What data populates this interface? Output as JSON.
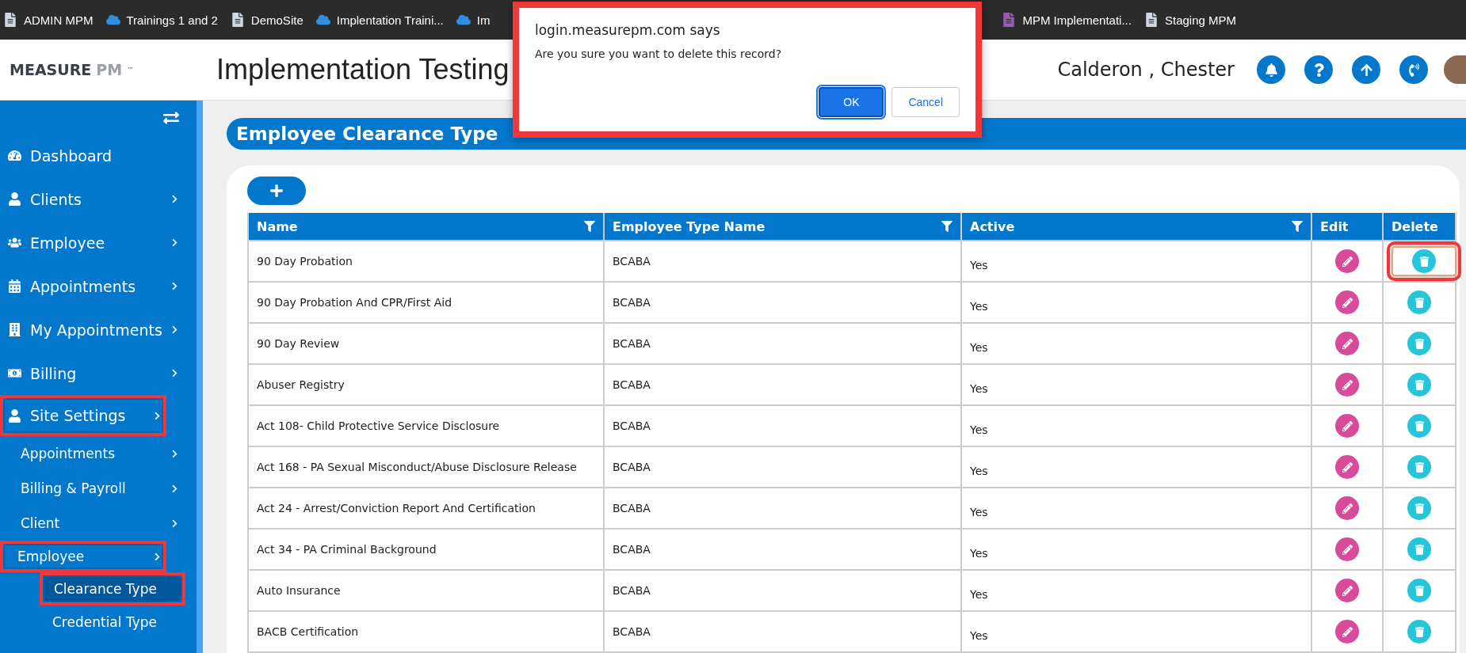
{
  "bookmarks": [
    {
      "label": "ADMIN MPM"
    },
    {
      "label": "Trainings 1 and 2"
    },
    {
      "label": "DemoSite"
    },
    {
      "label": "Implentation Traini..."
    },
    {
      "label": "Im"
    },
    {
      "label": "MPM Implementati..."
    },
    {
      "label": "Staging MPM"
    }
  ],
  "header": {
    "logo_main": "MEASURE",
    "logo_accent": "PM",
    "logo_tm": "™",
    "title": "Implementation Testing",
    "user": "Calderon , Chester",
    "actions": [
      {
        "kind": "bell"
      },
      {
        "kind": "help"
      },
      {
        "kind": "upload"
      },
      {
        "kind": "phone"
      }
    ]
  },
  "sidebar": {
    "items": [
      {
        "label": "Dashboard",
        "expandable": false,
        "highlighted": false
      },
      {
        "label": "Clients",
        "expandable": true,
        "highlighted": false
      },
      {
        "label": "Employee",
        "expandable": true,
        "highlighted": false
      },
      {
        "label": "Appointments",
        "expandable": true,
        "highlighted": false
      },
      {
        "label": "My Appointments",
        "expandable": true,
        "highlighted": false
      },
      {
        "label": "Billing",
        "expandable": true,
        "highlighted": false
      },
      {
        "label": "Site Settings",
        "expandable": true,
        "highlighted": true,
        "children": [
          {
            "label": "Appointments",
            "expandable": true,
            "highlighted": false
          },
          {
            "label": "Billing & Payroll",
            "expandable": true,
            "highlighted": false
          },
          {
            "label": "Client",
            "expandable": true,
            "highlighted": false
          },
          {
            "label": "Employee",
            "expandable": true,
            "highlighted": true,
            "children": [
              {
                "label": "Clearance Type",
                "selected": true,
                "highlighted": true
              },
              {
                "label": "Credential Type",
                "selected": false,
                "highlighted": false
              }
            ]
          }
        ]
      }
    ]
  },
  "page_title": "Employee Clearance Type",
  "table": {
    "columns": [
      {
        "label": "Name",
        "filter": true
      },
      {
        "label": "Employee Type Name",
        "filter": true
      },
      {
        "label": "Active",
        "filter": true
      },
      {
        "label": "Edit",
        "filter": false
      },
      {
        "label": "Delete",
        "filter": false
      }
    ],
    "rows": [
      {
        "name": "90 Day Probation",
        "type": "BCABA",
        "active": "Yes",
        "delete_highlighted": true
      },
      {
        "name": "90 Day Probation And CPR/First Aid",
        "type": "BCABA",
        "active": "Yes",
        "delete_highlighted": false
      },
      {
        "name": "90 Day Review",
        "type": "BCABA",
        "active": "Yes",
        "delete_highlighted": false
      },
      {
        "name": "Abuser Registry",
        "type": "BCABA",
        "active": "Yes",
        "delete_highlighted": false
      },
      {
        "name": "Act 108- Child Protective Service Disclosure",
        "type": "BCABA",
        "active": "Yes",
        "delete_highlighted": false
      },
      {
        "name": "Act 168 - PA Sexual Misconduct/Abuse Disclosure Release",
        "type": "BCABA",
        "active": "Yes",
        "delete_highlighted": false
      },
      {
        "name": "Act 24 - Arrest/Conviction Report And Certification",
        "type": "BCABA",
        "active": "Yes",
        "delete_highlighted": false
      },
      {
        "name": "Act 34 - PA Criminal Background",
        "type": "BCABA",
        "active": "Yes",
        "delete_highlighted": false
      },
      {
        "name": "Auto Insurance",
        "type": "BCABA",
        "active": "Yes",
        "delete_highlighted": false
      },
      {
        "name": "BACB Certification",
        "type": "BCABA",
        "active": "Yes",
        "delete_highlighted": false
      }
    ]
  },
  "dialog": {
    "title": "login.measurepm.com says",
    "message": "Are you sure you want to delete this record?",
    "buttons": [
      {
        "label": "OK",
        "selected": true
      },
      {
        "label": "Cancel",
        "selected": false
      }
    ],
    "highlighted": true
  }
}
